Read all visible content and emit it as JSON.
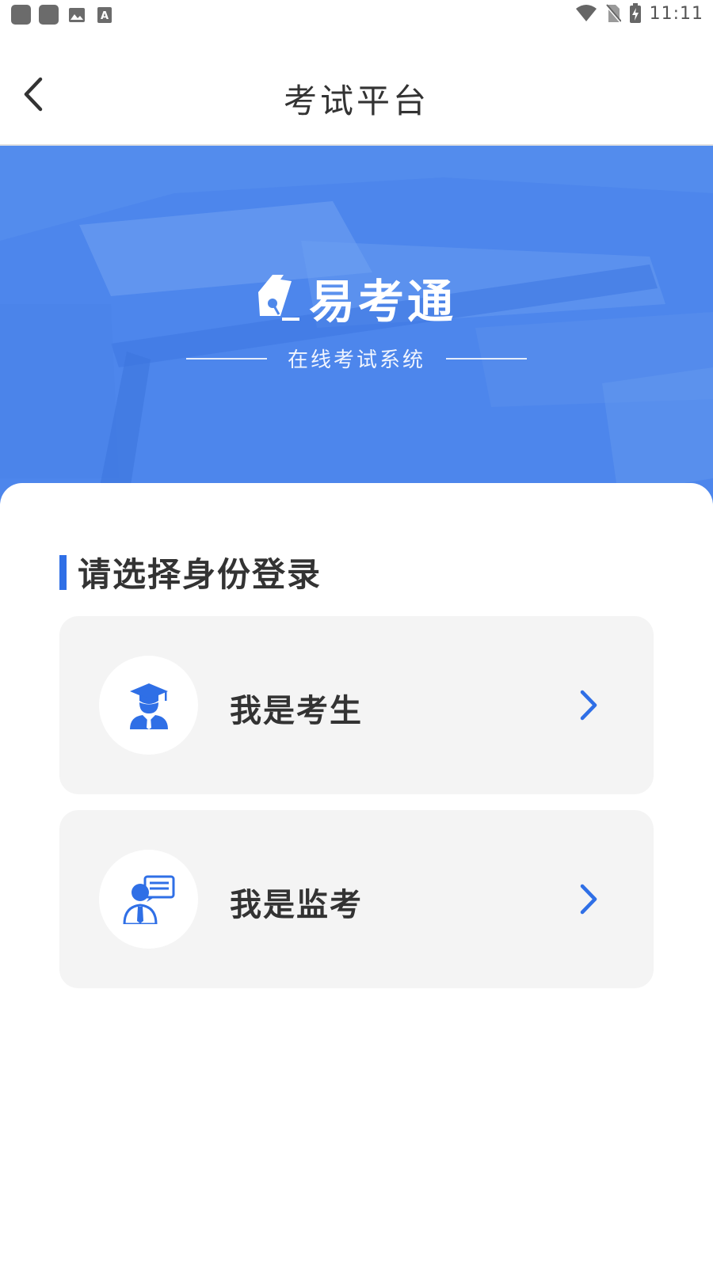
{
  "status_bar": {
    "time": "11:11"
  },
  "nav": {
    "title": "考试平台"
  },
  "banner": {
    "brand_name": "易考通",
    "subtitle": "在线考试系统"
  },
  "login": {
    "heading": "请选择身份登录",
    "options": [
      {
        "label": "我是考生",
        "icon": "student-graduate-icon"
      },
      {
        "label": "我是监考",
        "icon": "proctor-speech-icon"
      }
    ]
  },
  "colors": {
    "accent": "#2f6fe6",
    "banner": "#4f88ea",
    "card_bg": "#f4f4f4",
    "text": "#333333"
  }
}
